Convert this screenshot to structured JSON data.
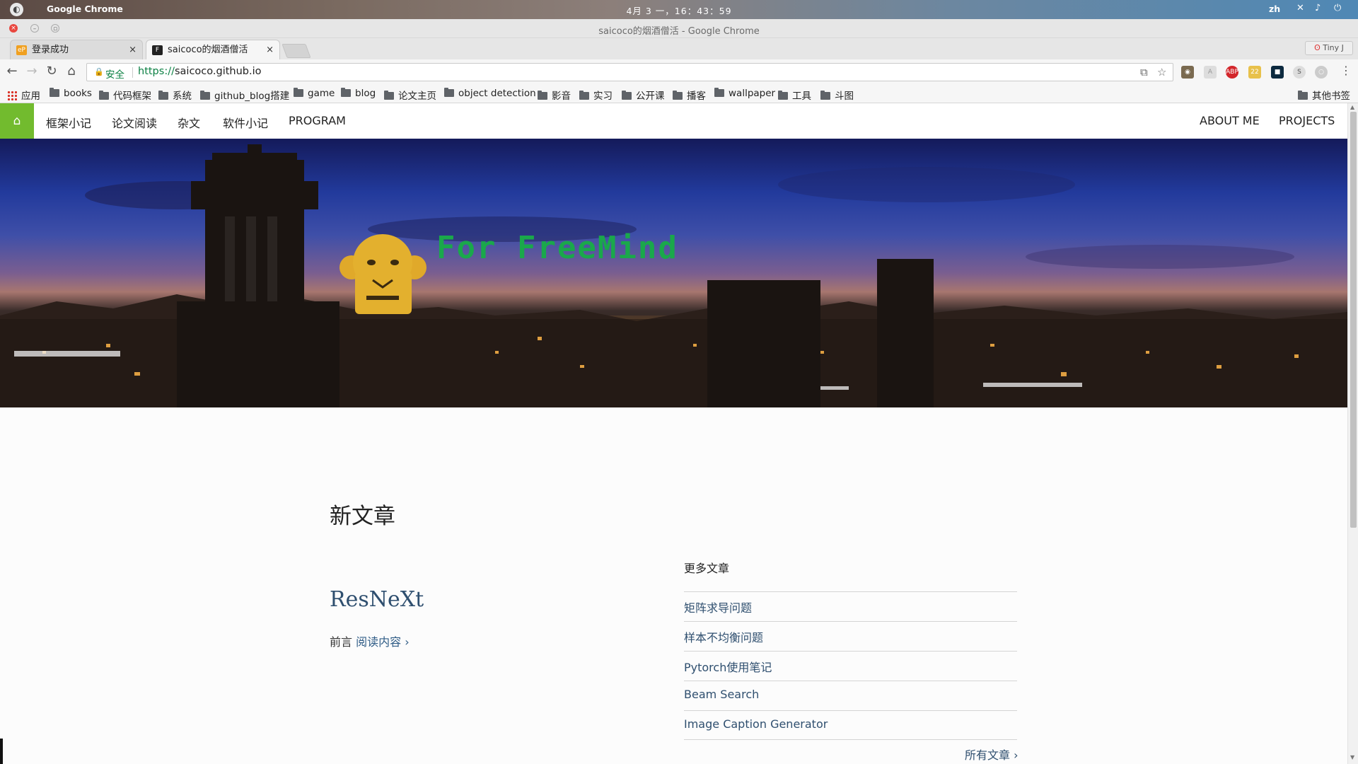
{
  "os": {
    "app_name": "Google Chrome",
    "clock": "4月 3 一，16：43：59",
    "lang": "zh"
  },
  "window": {
    "title": "saicoco的烟酒僧活 - Google Chrome"
  },
  "tabs": [
    {
      "label": "登录成功",
      "favicon": "eP"
    },
    {
      "label": "saicoco的烟酒僧活",
      "favicon": "F"
    }
  ],
  "profile": {
    "label": "Tiny J"
  },
  "omnibox": {
    "security_label": "安全",
    "scheme": "https://",
    "host": "saicoco.github.io"
  },
  "bookmarks": {
    "apps_label": "应用",
    "items": [
      "books",
      "代码框架",
      "系统",
      "github_blog搭建",
      "game",
      "blog",
      "论文主页",
      "object detection",
      "影音",
      "实习",
      "公开课",
      "播客",
      "wallpaper",
      "工具",
      "斗图"
    ],
    "other": "其他书签"
  },
  "site_nav": {
    "left": [
      "框架小记",
      "论文阅读",
      "杂文",
      "软件小记",
      "PROGRAM"
    ],
    "right": [
      "ABOUT ME",
      "PROJECTS"
    ]
  },
  "hero": {
    "title": "For FreeMind"
  },
  "main": {
    "heading": "新文章",
    "post": {
      "title": "ResNeXt",
      "excerpt": "前言",
      "read_more": "阅读内容 ›"
    },
    "sidebar_heading": "更多文章",
    "more_posts": [
      "矩阵求导问题",
      "样本不均衡问题",
      "Pytorch使用笔记",
      "Beam Search",
      "Image Caption Generator"
    ],
    "all_posts": "所有文章 ›"
  },
  "colors": {
    "accent": "#72bb2e",
    "hero_title": "#1aa84b",
    "link": "#2f4f6f"
  }
}
